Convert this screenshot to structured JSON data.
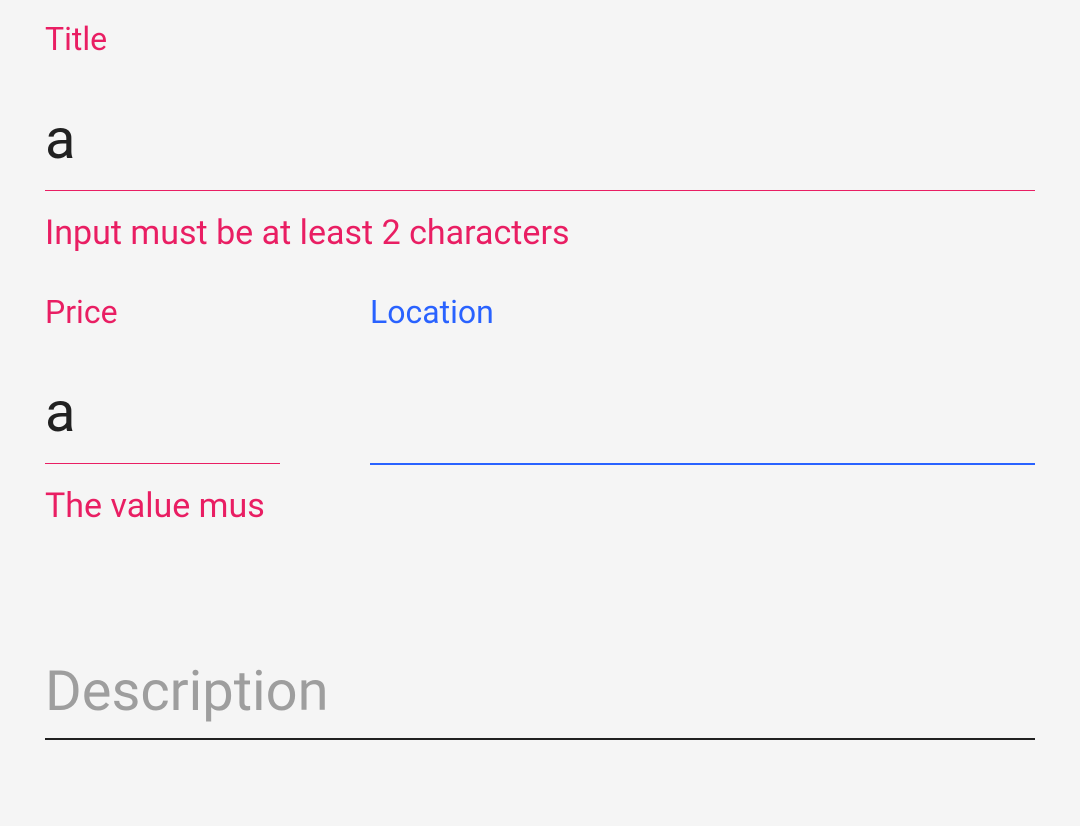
{
  "form": {
    "title": {
      "label": "Title",
      "value": "a",
      "error": "Input must be at least 2 characters"
    },
    "price": {
      "label": "Price",
      "value": "a",
      "error": "The value mus"
    },
    "location": {
      "label": "Location",
      "value": ""
    },
    "description": {
      "placeholder": "Description",
      "value": ""
    }
  },
  "colors": {
    "error": "#e91e63",
    "focus": "#2962ff",
    "default": "#212121",
    "placeholder": "#9e9e9e"
  }
}
